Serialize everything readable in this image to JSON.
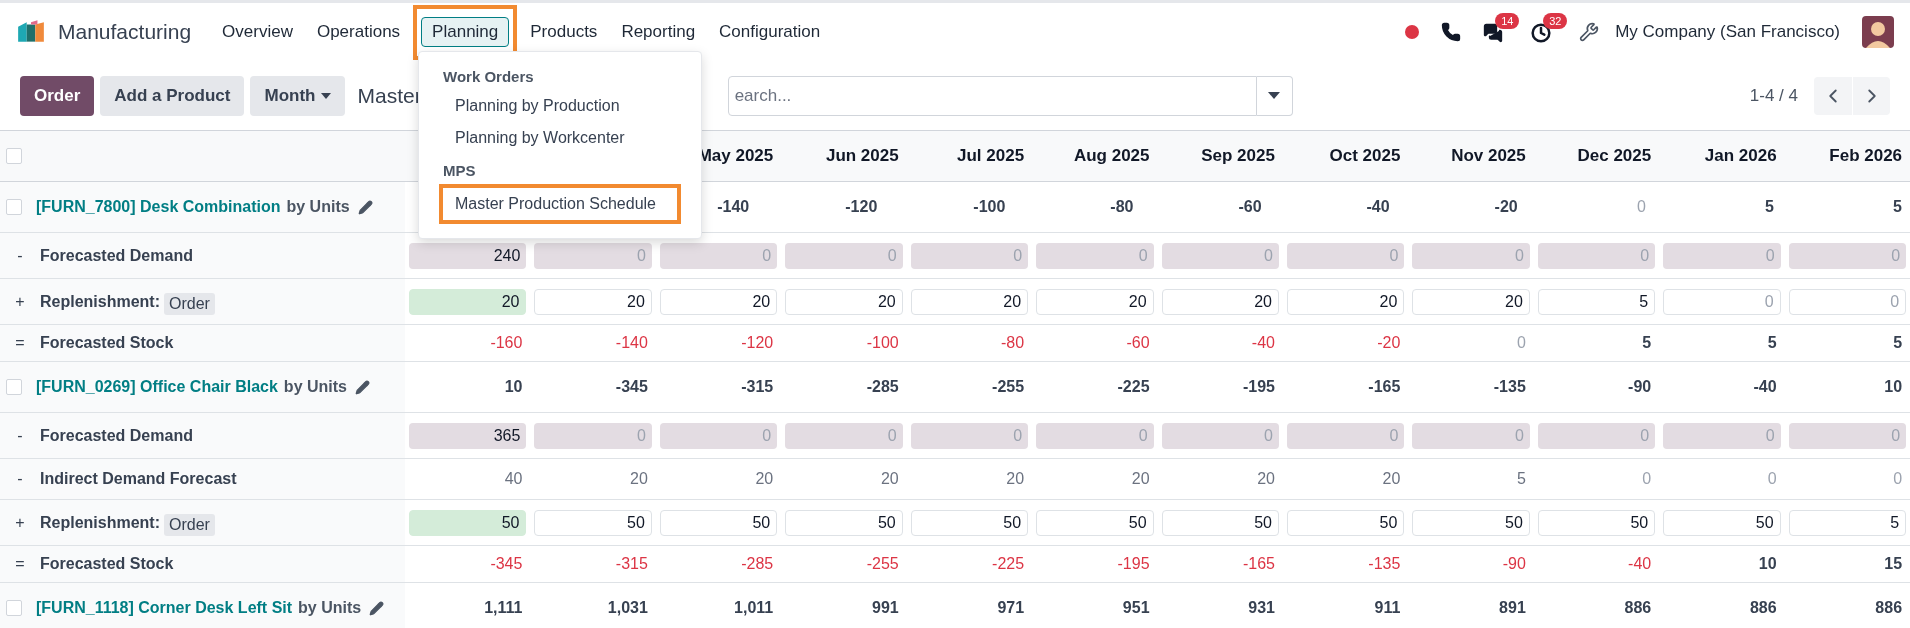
{
  "app": {
    "title": "Manufacturing"
  },
  "nav": [
    {
      "label": "Overview",
      "selected": false,
      "highlighted": false
    },
    {
      "label": "Operations",
      "selected": false,
      "highlighted": false
    },
    {
      "label": "Planning",
      "selected": true,
      "highlighted": true
    },
    {
      "label": "Products",
      "selected": false,
      "highlighted": false
    },
    {
      "label": "Reporting",
      "selected": false,
      "highlighted": false
    },
    {
      "label": "Configuration",
      "selected": false,
      "highlighted": false
    }
  ],
  "systray": {
    "messages_badge": "14",
    "activities_badge": "32",
    "company": "My Company (San Francisco)"
  },
  "menu": {
    "sections": [
      {
        "title": "Work Orders",
        "items": [
          {
            "label": "Planning by Production",
            "highlighted": false
          },
          {
            "label": "Planning by Workcenter",
            "highlighted": false
          }
        ]
      },
      {
        "title": "MPS",
        "items": [
          {
            "label": "Master Production Schedule",
            "highlighted": true
          }
        ]
      }
    ]
  },
  "control_panel": {
    "buttons": [
      "Order",
      "Add a Product"
    ],
    "period": "Month",
    "breadcrumb": "Master",
    "search": {
      "placeholder": "earch..."
    },
    "pager": "1-4 / 4"
  },
  "table": {
    "select_all_checked": false,
    "columns": [
      null,
      null,
      "May 2025",
      "Jun 2025",
      "Jul 2025",
      "Aug 2025",
      "Sep 2025",
      "Oct 2025",
      "Nov 2025",
      "Dec 2025",
      "Jan 2026",
      "Feb 2026"
    ],
    "rows": [
      {
        "kind": "product",
        "checked": false,
        "name": "[FURN_7800] Desk Combination",
        "unit": "by Units",
        "cells": [
          null,
          null,
          {
            "value": "-140",
            "muted": false
          },
          {
            "value": "-120",
            "muted": false
          },
          {
            "value": "-100",
            "muted": false
          },
          {
            "value": "-80",
            "muted": false
          },
          {
            "value": "-60",
            "muted": false
          },
          {
            "value": "-40",
            "muted": false
          },
          {
            "value": "-20",
            "muted": false
          },
          {
            "value": "0",
            "muted": true
          },
          {
            "value": "5",
            "muted": false
          },
          {
            "value": "5",
            "muted": false
          }
        ]
      },
      {
        "kind": "demand",
        "sign": "-",
        "label": "Forecasted Demand",
        "cells": [
          {
            "value": "240",
            "muted": false
          },
          {
            "value": "0",
            "muted": true
          },
          {
            "value": "0",
            "muted": true
          },
          {
            "value": "0",
            "muted": true
          },
          {
            "value": "0",
            "muted": true
          },
          {
            "value": "0",
            "muted": true
          },
          {
            "value": "0",
            "muted": true
          },
          {
            "value": "0",
            "muted": true
          },
          {
            "value": "0",
            "muted": true
          },
          {
            "value": "0",
            "muted": true
          },
          {
            "value": "0",
            "muted": true
          },
          {
            "value": "0",
            "muted": true
          }
        ]
      },
      {
        "kind": "replenishment",
        "sign": "+",
        "label": "Replenishment:",
        "action": "Order",
        "cells": [
          {
            "value": "20",
            "muted": false,
            "proposed": true
          },
          {
            "value": "20",
            "muted": false,
            "proposed": false
          },
          {
            "value": "20",
            "muted": false,
            "proposed": false
          },
          {
            "value": "20",
            "muted": false,
            "proposed": false
          },
          {
            "value": "20",
            "muted": false,
            "proposed": false
          },
          {
            "value": "20",
            "muted": false,
            "proposed": false
          },
          {
            "value": "20",
            "muted": false,
            "proposed": false
          },
          {
            "value": "20",
            "muted": false,
            "proposed": false
          },
          {
            "value": "20",
            "muted": false,
            "proposed": false
          },
          {
            "value": "5",
            "muted": false,
            "proposed": false
          },
          {
            "value": "0",
            "muted": true,
            "proposed": false
          },
          {
            "value": "0",
            "muted": true,
            "proposed": false
          }
        ]
      },
      {
        "kind": "stock",
        "sign": "=",
        "label": "Forecasted Stock",
        "cells": [
          {
            "value": "-160",
            "muted": false,
            "negative": true
          },
          {
            "value": "-140",
            "muted": false,
            "negative": true
          },
          {
            "value": "-120",
            "muted": false,
            "negative": true
          },
          {
            "value": "-100",
            "muted": false,
            "negative": true
          },
          {
            "value": "-80",
            "muted": false,
            "negative": true
          },
          {
            "value": "-60",
            "muted": false,
            "negative": true
          },
          {
            "value": "-40",
            "muted": false,
            "negative": true
          },
          {
            "value": "-20",
            "muted": false,
            "negative": true
          },
          {
            "value": "0",
            "muted": true,
            "negative": false
          },
          {
            "value": "5",
            "muted": false,
            "negative": false
          },
          {
            "value": "5",
            "muted": false,
            "negative": false
          },
          {
            "value": "5",
            "muted": false,
            "negative": false
          }
        ]
      },
      {
        "kind": "product",
        "checked": false,
        "name": "[FURN_0269] Office Chair Black",
        "unit": "by Units",
        "cells": [
          {
            "value": "10",
            "muted": false
          },
          {
            "value": "-345",
            "muted": false
          },
          {
            "value": "-315",
            "muted": false
          },
          {
            "value": "-285",
            "muted": false
          },
          {
            "value": "-255",
            "muted": false
          },
          {
            "value": "-225",
            "muted": false
          },
          {
            "value": "-195",
            "muted": false
          },
          {
            "value": "-165",
            "muted": false
          },
          {
            "value": "-135",
            "muted": false
          },
          {
            "value": "-90",
            "muted": false
          },
          {
            "value": "-40",
            "muted": false
          },
          {
            "value": "10",
            "muted": false
          }
        ]
      },
      {
        "kind": "demand",
        "sign": "-",
        "label": "Forecasted Demand",
        "cells": [
          {
            "value": "365",
            "muted": false
          },
          {
            "value": "0",
            "muted": true
          },
          {
            "value": "0",
            "muted": true
          },
          {
            "value": "0",
            "muted": true
          },
          {
            "value": "0",
            "muted": true
          },
          {
            "value": "0",
            "muted": true
          },
          {
            "value": "0",
            "muted": true
          },
          {
            "value": "0",
            "muted": true
          },
          {
            "value": "0",
            "muted": true
          },
          {
            "value": "0",
            "muted": true
          },
          {
            "value": "0",
            "muted": true
          },
          {
            "value": "0",
            "muted": true
          }
        ]
      },
      {
        "kind": "indirect",
        "sign": "-",
        "label": "Indirect Demand Forecast",
        "cells": [
          {
            "value": "40",
            "muted": false
          },
          {
            "value": "20",
            "muted": false
          },
          {
            "value": "20",
            "muted": false
          },
          {
            "value": "20",
            "muted": false
          },
          {
            "value": "20",
            "muted": false
          },
          {
            "value": "20",
            "muted": false
          },
          {
            "value": "20",
            "muted": false
          },
          {
            "value": "20",
            "muted": false
          },
          {
            "value": "5",
            "muted": false
          },
          {
            "value": "0",
            "muted": true
          },
          {
            "value": "0",
            "muted": true
          },
          {
            "value": "0",
            "muted": true
          }
        ]
      },
      {
        "kind": "replenishment",
        "sign": "+",
        "label": "Replenishment:",
        "action": "Order",
        "cells": [
          {
            "value": "50",
            "muted": false,
            "proposed": true
          },
          {
            "value": "50",
            "muted": false,
            "proposed": false
          },
          {
            "value": "50",
            "muted": false,
            "proposed": false
          },
          {
            "value": "50",
            "muted": false,
            "proposed": false
          },
          {
            "value": "50",
            "muted": false,
            "proposed": false
          },
          {
            "value": "50",
            "muted": false,
            "proposed": false
          },
          {
            "value": "50",
            "muted": false,
            "proposed": false
          },
          {
            "value": "50",
            "muted": false,
            "proposed": false
          },
          {
            "value": "50",
            "muted": false,
            "proposed": false
          },
          {
            "value": "50",
            "muted": false,
            "proposed": false
          },
          {
            "value": "50",
            "muted": false,
            "proposed": false
          },
          {
            "value": "5",
            "muted": false,
            "proposed": false
          }
        ]
      },
      {
        "kind": "stock",
        "sign": "=",
        "label": "Forecasted Stock",
        "cells": [
          {
            "value": "-345",
            "muted": false,
            "negative": true
          },
          {
            "value": "-315",
            "muted": false,
            "negative": true
          },
          {
            "value": "-285",
            "muted": false,
            "negative": true
          },
          {
            "value": "-255",
            "muted": false,
            "negative": true
          },
          {
            "value": "-225",
            "muted": false,
            "negative": true
          },
          {
            "value": "-195",
            "muted": false,
            "negative": true
          },
          {
            "value": "-165",
            "muted": false,
            "negative": true
          },
          {
            "value": "-135",
            "muted": false,
            "negative": true
          },
          {
            "value": "-90",
            "muted": false,
            "negative": true
          },
          {
            "value": "-40",
            "muted": false,
            "negative": true
          },
          {
            "value": "10",
            "muted": false,
            "negative": false
          },
          {
            "value": "15",
            "muted": false,
            "negative": false
          }
        ]
      },
      {
        "kind": "product",
        "checked": false,
        "name": "[FURN_1118] Corner Desk Left Sit",
        "unit": "by Units",
        "cells": [
          {
            "value": "1,111",
            "muted": false
          },
          {
            "value": "1,031",
            "muted": false
          },
          {
            "value": "1,011",
            "muted": false
          },
          {
            "value": "991",
            "muted": false
          },
          {
            "value": "971",
            "muted": false
          },
          {
            "value": "951",
            "muted": false
          },
          {
            "value": "931",
            "muted": false
          },
          {
            "value": "911",
            "muted": false
          },
          {
            "value": "891",
            "muted": false
          },
          {
            "value": "886",
            "muted": false
          },
          {
            "value": "886",
            "muted": false
          },
          {
            "value": "886",
            "muted": false
          }
        ]
      }
    ]
  }
}
